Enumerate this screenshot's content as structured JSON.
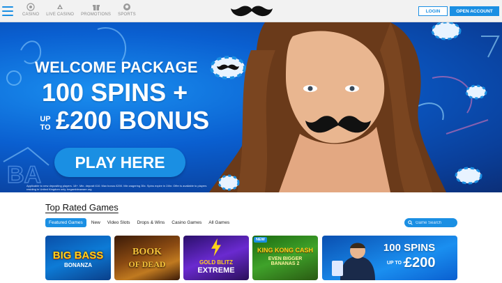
{
  "header": {
    "nav": [
      {
        "label": "CASINO",
        "icon": "casino-chip-icon"
      },
      {
        "label": "LIVE CASINO",
        "icon": "live-casino-icon"
      },
      {
        "label": "PROMOTIONS",
        "icon": "promotions-gift-icon"
      },
      {
        "label": "SPORTS",
        "icon": "sports-ball-icon"
      }
    ],
    "logo_icon": "mustache-logo-icon",
    "login_label": "LOGIN",
    "open_account_label": "OPEN ACCOUNT"
  },
  "hero": {
    "line1": "WELCOME PACKAGE",
    "line2": "100 SPINS +",
    "up_to": "UP TO",
    "line3": "£200 BONUS",
    "cta_label": "PLAY HERE",
    "disclaimer": "Applicable to new depositing players. 18+. Min. deposit £10. Max bonus £200. Min wagering 35x. Spins expire in 24hr. Offer is available to players residing in United Kingdom only. begambleaware.org"
  },
  "games": {
    "title": "Top Rated Games",
    "tabs": [
      "Featured Games",
      "New",
      "Video Slots",
      "Drops & Wins",
      "Casino Games",
      "All Games"
    ],
    "active_tab": "Featured Games",
    "search_placeholder": "Game Search",
    "tiles": [
      {
        "title_line1": "BIG BASS",
        "title_line2": "BONANZA",
        "badge": ""
      },
      {
        "title_line1": "BOOK",
        "title_line2": "OF DEAD",
        "badge": ""
      },
      {
        "title_line1": "GOLD BLITZ",
        "title_line2": "EXTREME",
        "badge": ""
      },
      {
        "title_line1": "KING KONG CASH",
        "title_line2": "EVEN BIGGER BANANAS 2",
        "badge": "NEW"
      },
      {
        "title_line1": "100 SPINS",
        "title_line2": "£200",
        "up_to": "UP TO +",
        "badge": ""
      }
    ]
  },
  "colors": {
    "accent": "#1a8fe3",
    "hero_blue": "#0a5fd0",
    "header_bg": "#f2f2f2"
  }
}
